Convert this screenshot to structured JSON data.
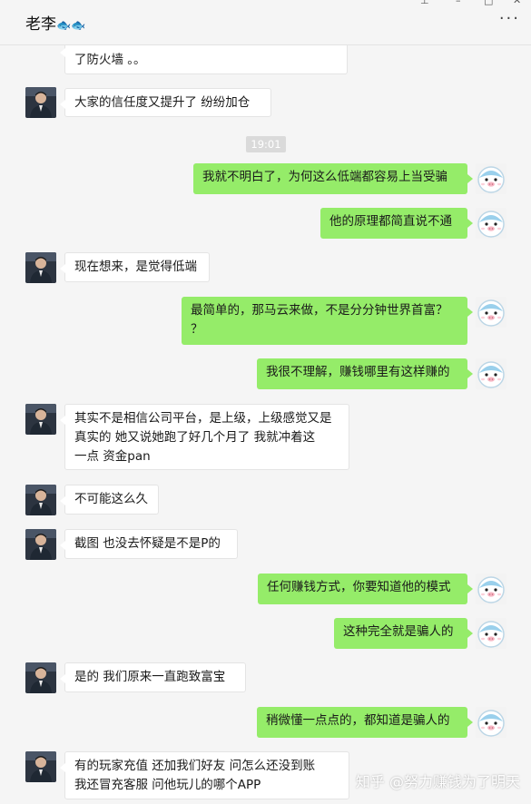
{
  "header": {
    "title": "老李",
    "emoji": "🐟🐟",
    "pin_icon": "⊥",
    "min_icon": "–",
    "max_icon": "□",
    "close_icon": "✕",
    "more_icon": "···"
  },
  "timestamp": "19:01",
  "messages": [
    {
      "side": "in",
      "lines": [
        "了防火墙 。。"
      ]
    },
    {
      "side": "in",
      "lines": [
        "大家的信任度又提升了   纷纷加仓"
      ]
    },
    {
      "side": "out",
      "lines": [
        "我就不明白了，为何这么低端都容易上当受骗"
      ]
    },
    {
      "side": "out",
      "lines": [
        "他的原理都简直说不通"
      ]
    },
    {
      "side": "in",
      "lines": [
        "现在想来，是觉得低端"
      ]
    },
    {
      "side": "out",
      "lines": [
        "最简单的，那马云来做，不是分分钟世界首富？",
        "？"
      ]
    },
    {
      "side": "out",
      "lines": [
        "我很不理解，赚钱哪里有这样赚的"
      ]
    },
    {
      "side": "in",
      "lines": [
        "其实不是相信公司平台，是上级，上级感觉又是",
        "真实的    她又说她跑了好几个月了    我就冲着这",
        "一点  资金pan"
      ]
    },
    {
      "side": "in",
      "lines": [
        "不可能这么久"
      ]
    },
    {
      "side": "in",
      "lines": [
        "截图  也没去怀疑是不是P的"
      ]
    },
    {
      "side": "out",
      "lines": [
        "任何赚钱方式，你要知道他的模式"
      ]
    },
    {
      "side": "out",
      "lines": [
        "这种完全就是骗人的"
      ]
    },
    {
      "side": "in",
      "lines": [
        "是的   我们原来一直跑致富宝"
      ]
    },
    {
      "side": "out",
      "lines": [
        "稍微懂一点点的，都知道是骗人的"
      ]
    },
    {
      "side": "in",
      "lines": [
        "有的玩家充值   还加我们好友   问怎么还没到账",
        "我还冒充客服 问他玩儿的哪个APP"
      ]
    }
  ],
  "watermark": "知乎 @努力赚钱为了明天",
  "colors": {
    "outgoing_bubble": "#95ec69",
    "incoming_bubble": "#ffffff",
    "background": "#f5f5f5"
  }
}
